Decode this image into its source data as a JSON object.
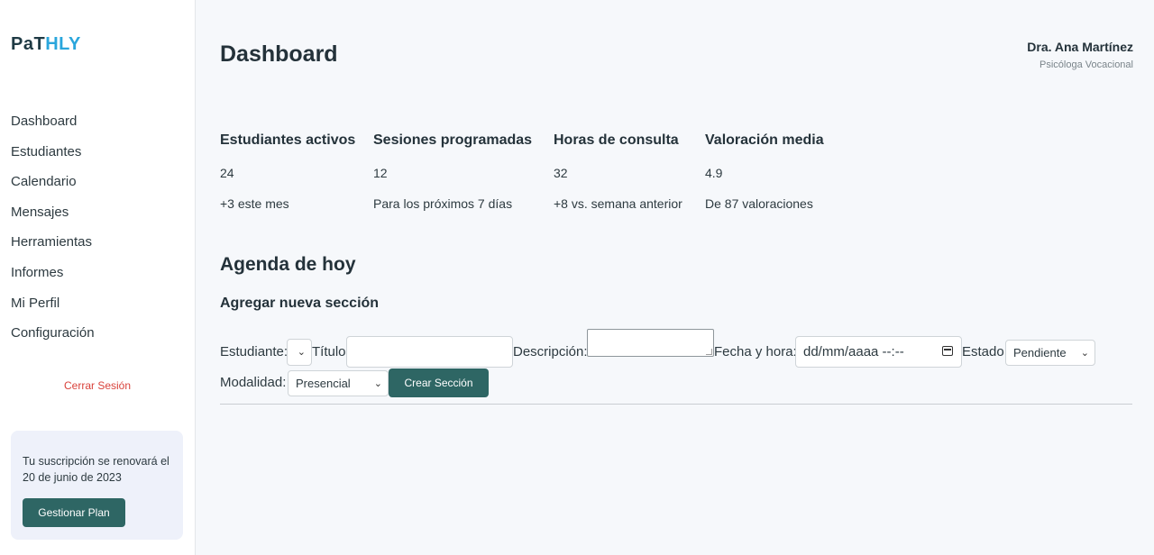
{
  "app": {
    "logo_part1": "PaT",
    "logo_part2": "HLY"
  },
  "sidebar": {
    "items": [
      {
        "label": "Dashboard"
      },
      {
        "label": "Estudiantes"
      },
      {
        "label": "Calendario"
      },
      {
        "label": "Mensajes"
      },
      {
        "label": "Herramientas"
      },
      {
        "label": "Informes"
      },
      {
        "label": "Mi Perfil"
      },
      {
        "label": "Configuración"
      }
    ],
    "logout_label": "Cerrar Sesión",
    "plan": {
      "message": "Tu suscripción se renovará el 20 de junio de 2023",
      "button_label": "Gestionar Plan"
    }
  },
  "header": {
    "title": "Dashboard",
    "user_name": "Dra. Ana Martínez",
    "user_role": "Psicóloga Vocacional"
  },
  "stats": [
    {
      "label": "Estudiantes activos",
      "value": "24",
      "sub": "+3 este mes"
    },
    {
      "label": "Sesiones programadas",
      "value": "12",
      "sub": "Para los próximos 7 días"
    },
    {
      "label": "Horas de consulta",
      "value": "32",
      "sub": "+8 vs. semana anterior"
    },
    {
      "label": "Valoración media",
      "value": "4.9",
      "sub": "De 87 valoraciones"
    }
  ],
  "agenda": {
    "title": "Agenda de hoy",
    "form_title": "Agregar nueva sección",
    "fields": {
      "student_label": "Estudiante:",
      "student_value": "",
      "title_label": "Título:",
      "title_value": "",
      "description_label": "Descripción:",
      "description_value": "",
      "datetime_label": "Fecha y hora:",
      "datetime_placeholder": "dd/mm/aaaa --:--",
      "status_label": "Estado:",
      "status_value": "Pendiente",
      "modality_label": "Modalidad:",
      "modality_value": "Presencial"
    },
    "create_button_label": "Crear Sección"
  },
  "colors": {
    "accent": "#2e6664",
    "logo_blue": "#2aa6dc",
    "logout_red": "#d9423b"
  }
}
